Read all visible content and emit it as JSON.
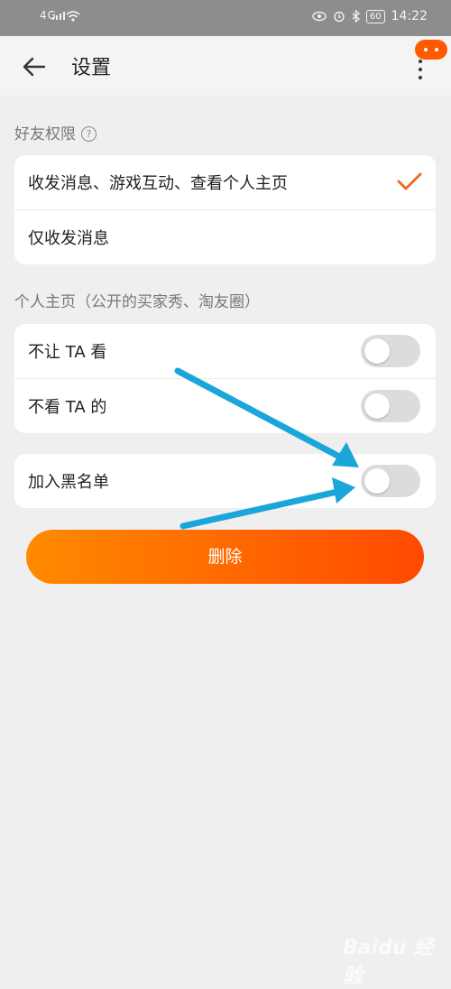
{
  "status_bar": {
    "network": "4G",
    "battery": "60",
    "time": "14:22"
  },
  "header": {
    "title": "设置"
  },
  "friend_permissions": {
    "section_title": "好友权限",
    "options": [
      {
        "label": "收发消息、游戏互动、查看个人主页",
        "selected": true
      },
      {
        "label": "仅收发消息",
        "selected": false
      }
    ]
  },
  "profile": {
    "section_title": "个人主页（公开的买家秀、淘友圈）",
    "toggles": [
      {
        "label": "不让 TA 看",
        "on": false
      },
      {
        "label": "不看 TA 的",
        "on": false
      }
    ]
  },
  "blacklist": {
    "label": "加入黑名单",
    "on": false
  },
  "delete_label": "删除",
  "watermark": "Baidu 经验",
  "colors": {
    "accent": "#ff5a00",
    "arrow": "#1aa6d8",
    "check": "#ee6a2a"
  }
}
